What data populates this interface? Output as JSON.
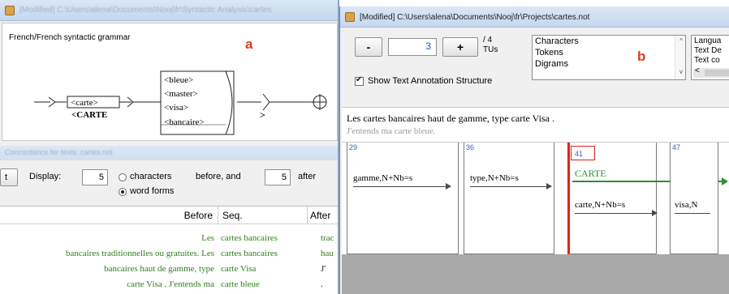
{
  "left_window": {
    "title": "[Modified] C:\\Users\\alena\\Documents\\Nooj\\fr\\Syntactic Analysis\\cartes",
    "grammar_title": "French/French syntactic grammar",
    "panel_label": "a",
    "graph": {
      "box_carte": "<carte>",
      "label_carte": "<CARTE",
      "alternatives": [
        "<bleue>",
        "<master>",
        "<visa>",
        "<bancaire>"
      ],
      "output_symbol": ">"
    },
    "concordance_title": "Concordance for texts: cartes.not",
    "display": {
      "button_label": "t",
      "display_label": "Display:",
      "before_value": "5",
      "characters_label": "characters",
      "before_and_label": "before, and",
      "after_value": "5",
      "after_label": "after",
      "word_forms_label": "word forms",
      "selected": "word forms"
    },
    "table": {
      "headers": [
        "Before",
        "Seq.",
        "After"
      ],
      "rows": [
        {
          "before": "Les",
          "seq": "cartes bancaires",
          "after": "trac"
        },
        {
          "before": "bancaires traditionnelles ou gratuites. Les",
          "seq": "cartes bancaires",
          "after": "hau"
        },
        {
          "before": "bancaires haut de gamme, type",
          "seq": "carte Visa",
          "after": "J'"
        },
        {
          "before": "carte Visa . J'entends ma",
          "seq": "carte bleue",
          "after": "."
        }
      ]
    }
  },
  "right_window": {
    "title": "[Modified] C:\\Users\\alena\\Documents\\Nooj\\fr\\Projects\\cartes.not",
    "minus_label": "-",
    "plus_label": "+",
    "sentence_number": "3",
    "sentence_count": "/ 4",
    "tus_label": "TUs",
    "show_annotation_label": "Show Text Annotation Structure",
    "show_annotation_checked": true,
    "layers": [
      "Characters",
      "Tokens",
      "Digrams"
    ],
    "panel_label": "b",
    "language_items": [
      "Langua",
      "Text De",
      "Text co",
      "<"
    ],
    "sentence_text": "Les cartes bancaires haut de gamme, type carte Visa .",
    "next_sentence_text": "J'entends ma carte bleue.",
    "tfst": {
      "tu_ids": [
        "29",
        "36",
        "41",
        "47"
      ],
      "tokens": [
        "gamme,N+Nb=s",
        "type,N+Nb=s",
        "carte,N+Nb=s",
        "visa,N"
      ],
      "annotation": "CARTE"
    }
  },
  "colors": {
    "concordance_text": "#2f7d1f",
    "annotation_green": "#2f8f2f",
    "highlight_red": "#e02020",
    "label_red": "#e03a1e",
    "tu_id_blue": "#3b5bc6"
  }
}
